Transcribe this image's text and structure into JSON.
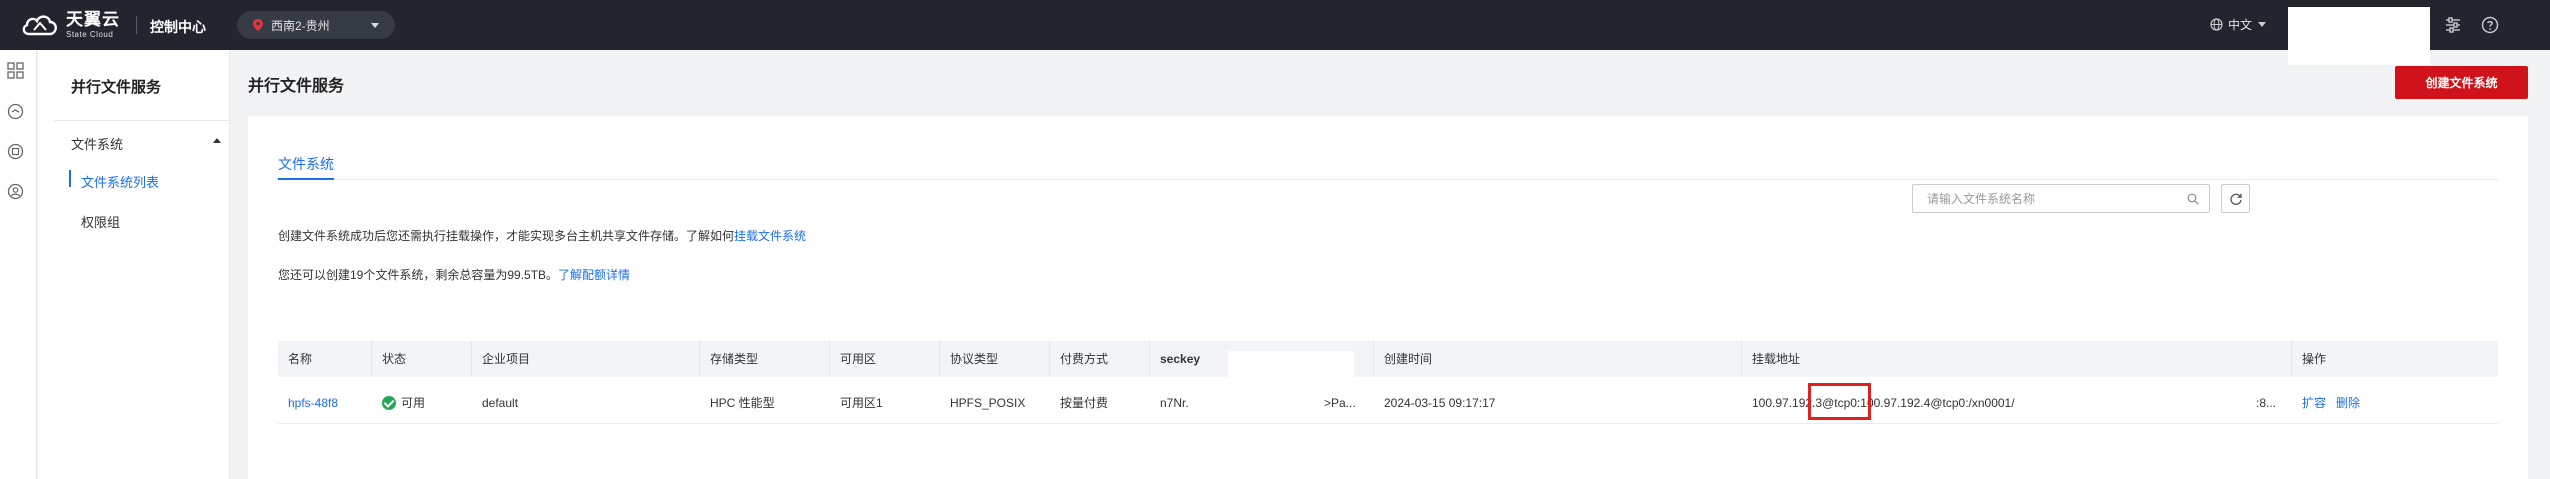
{
  "header": {
    "logo_cn": "天翼云",
    "logo_en": "State Cloud",
    "console_title": "控制中心",
    "region": "西南2-贵州",
    "language": "中文",
    "icons": [
      "settings-sliders-icon",
      "help-icon"
    ]
  },
  "rail": {
    "icons": [
      "grid-icon",
      "service-icon",
      "storage-icon",
      "user-circle-icon"
    ]
  },
  "sidebar": {
    "title": "并行文件服务",
    "group": "文件系统",
    "items": [
      {
        "label": "文件系统列表",
        "active": true
      },
      {
        "label": "权限组",
        "active": false
      }
    ]
  },
  "page": {
    "title": "并行文件服务",
    "create_button": "创建文件系统",
    "tab": "文件系统",
    "tip1_text": "创建文件系统成功后您还需执行挂载操作，才能实现多台主机共享文件存储。了解如何",
    "tip1_link": "挂载文件系统",
    "tip2_text": "您还可以创建19个文件系统，剩余总容量为99.5TB。",
    "tip2_link": "了解配额详情",
    "search_placeholder": "请输入文件系统名称"
  },
  "table": {
    "columns": [
      "名称",
      "状态",
      "企业项目",
      "存储类型",
      "可用区",
      "协议类型",
      "付费方式",
      "seckey",
      "创建时间",
      "挂载地址",
      "操作"
    ],
    "rows": [
      {
        "name": "hpfs-48f8",
        "status": "可用",
        "project": "default",
        "storage_type": "HPC 性能型",
        "zone": "可用区1",
        "protocol": "HPFS_POSIX",
        "billing": "按量付费",
        "seckey_start": "n7Nr.",
        "seckey_end": ">Pa...",
        "created": "2024-03-15 09:17:17",
        "mount_address": "100.97.192.3@tcp0:100.97.192.4@tcp0:/xn0001/",
        "mount_tail": ":8...",
        "actions": [
          "扩容",
          "删除"
        ]
      }
    ]
  },
  "colors": {
    "accent": "#1b6ef3",
    "danger": "#d0121b",
    "topbar": "#22252d",
    "status_ok": "#26a65b"
  }
}
